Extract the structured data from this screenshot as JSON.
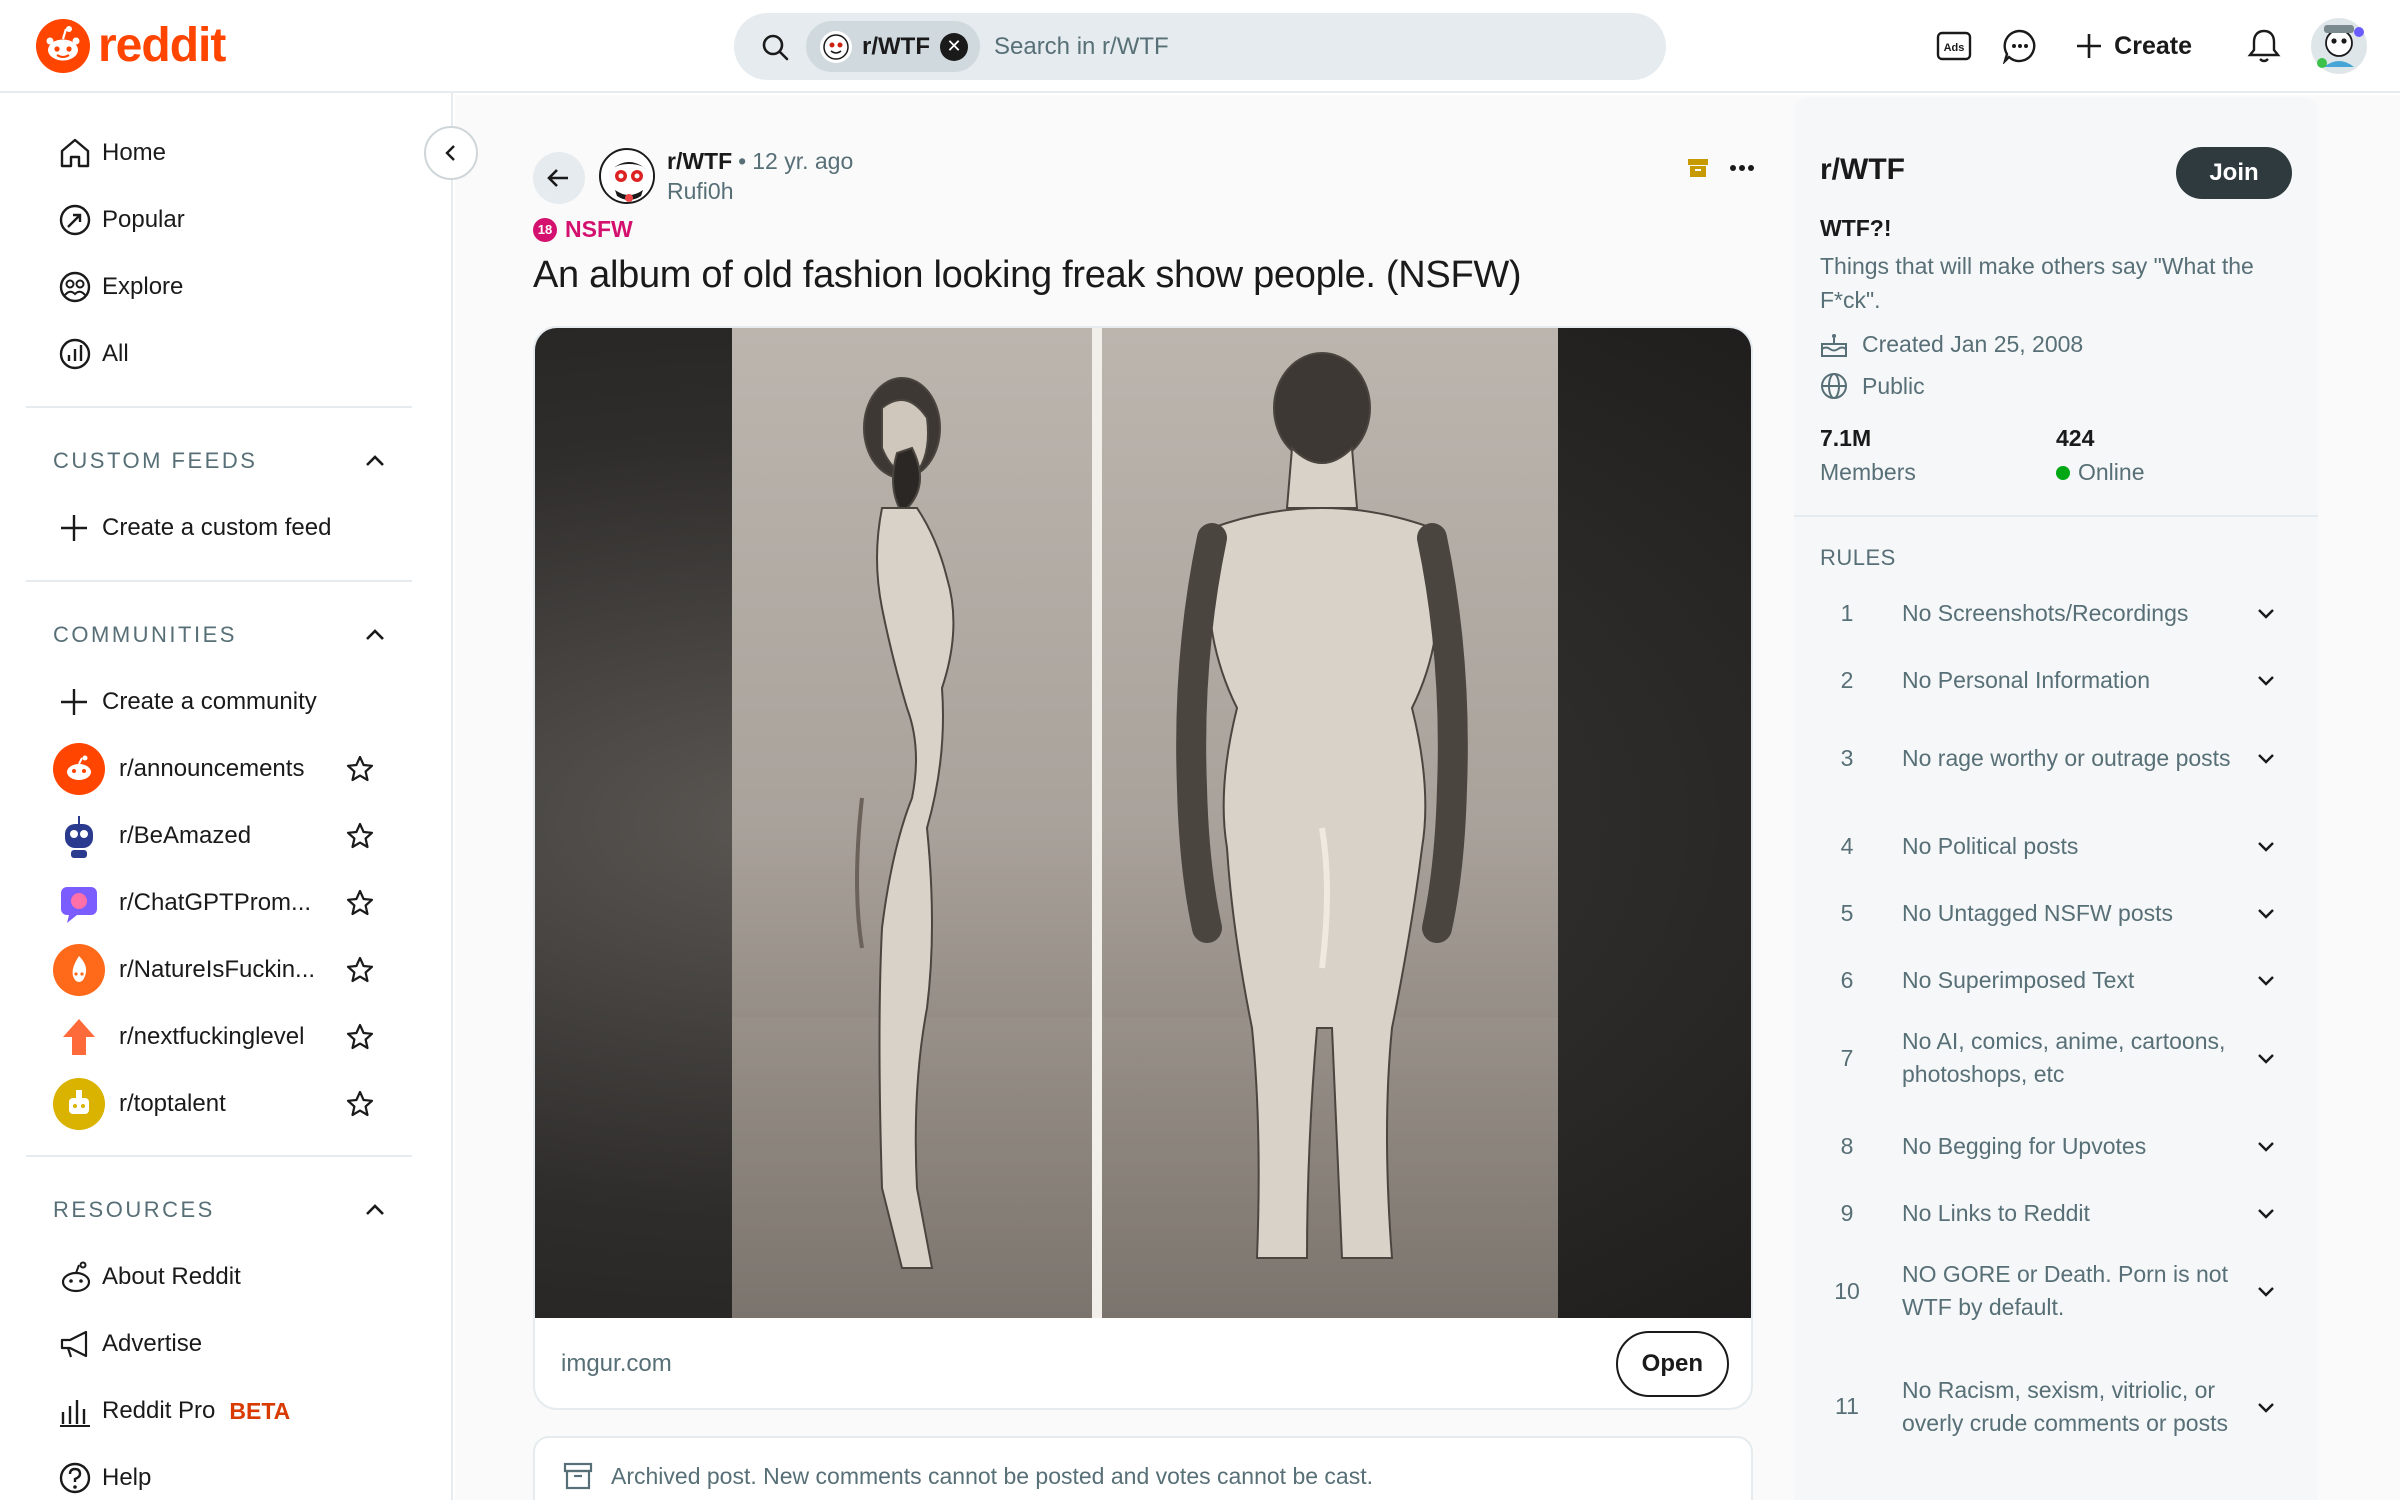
{
  "header": {
    "logo_text": "reddit",
    "search": {
      "chip_label": "r/WTF",
      "placeholder": "Search in r/WTF"
    },
    "ads_label": "Ads",
    "create_label": "Create"
  },
  "sidebar": {
    "nav": [
      {
        "label": "Home",
        "icon": "home-icon"
      },
      {
        "label": "Popular",
        "icon": "popular-icon"
      },
      {
        "label": "Explore",
        "icon": "explore-icon"
      },
      {
        "label": "All",
        "icon": "all-icon"
      }
    ],
    "custom_feeds": {
      "title": "CUSTOM FEEDS",
      "create_label": "Create a custom feed"
    },
    "communities": {
      "title": "COMMUNITIES",
      "create_label": "Create a community",
      "items": [
        {
          "name": "r/announcements",
          "color": "#ff4500"
        },
        {
          "name": "r/BeAmazed",
          "color": "#ffffff"
        },
        {
          "name": "r/ChatGPTProm...",
          "color": "#7a5cff"
        },
        {
          "name": "r/NatureIsFuckin...",
          "color": "#ff6a1a"
        },
        {
          "name": "r/nextfuckinglevel",
          "color": "#ffffff"
        },
        {
          "name": "r/toptalent",
          "color": "#d9b300"
        }
      ]
    },
    "resources": {
      "title": "RESOURCES",
      "items": [
        {
          "label": "About Reddit",
          "icon": "reddit-alien-icon"
        },
        {
          "label": "Advertise",
          "icon": "megaphone-icon"
        },
        {
          "label": "Reddit Pro",
          "icon": "bar-chart-icon",
          "badge": "BETA"
        },
        {
          "label": "Help",
          "icon": "help-icon"
        }
      ]
    }
  },
  "post": {
    "subreddit": "r/WTF",
    "separator": "•",
    "age": "12 yr. ago",
    "author": "Rufi0h",
    "nsfw_label": "NSFW",
    "nsfw_badge": "18",
    "title": "An album of old fashion looking freak show people. (NSFW)",
    "link_domain": "imgur.com",
    "open_label": "Open",
    "archived_notice": "Archived post. New comments cannot be posted and votes cannot be cast."
  },
  "community": {
    "name": "r/WTF",
    "join_label": "Join",
    "tagline": "WTF?!",
    "description": "Things that will make others say \"What the F*ck\".",
    "created": "Created Jan 25, 2008",
    "visibility": "Public",
    "members_count": "7.1M",
    "members_label": "Members",
    "online_count": "424",
    "online_label": "Online",
    "rules_title": "RULES",
    "rules": [
      {
        "n": "1",
        "text": "No Screenshots/Recordings"
      },
      {
        "n": "2",
        "text": "No Personal Information"
      },
      {
        "n": "3",
        "text": "No rage worthy or outrage posts"
      },
      {
        "n": "4",
        "text": "No Political posts"
      },
      {
        "n": "5",
        "text": "No Untagged NSFW posts"
      },
      {
        "n": "6",
        "text": "No Superimposed Text"
      },
      {
        "n": "7",
        "text": "No AI, comics, anime, cartoons, photoshops, etc"
      },
      {
        "n": "8",
        "text": "No Begging for Upvotes"
      },
      {
        "n": "9",
        "text": "No Links to Reddit"
      },
      {
        "n": "10",
        "text": "NO GORE or Death. Porn is not WTF by default."
      },
      {
        "n": "11",
        "text": "No Racism, sexism, vitriolic, or overly crude comments or posts"
      }
    ]
  },
  "colors": {
    "brand": "#ff4500",
    "nsfw": "#d4116e",
    "online": "#01a816",
    "join_bg": "#2f3a3e"
  }
}
